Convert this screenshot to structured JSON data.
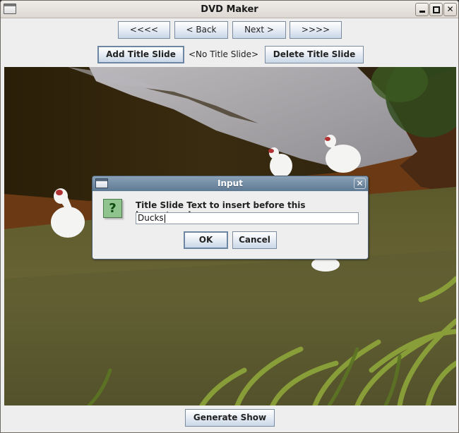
{
  "window": {
    "title": "DVD Maker",
    "controls": {
      "minimize": "minimize",
      "maximize": "maximize",
      "close": "close"
    }
  },
  "navigation": {
    "first_label": "<<<<",
    "back_label": "< Back",
    "next_label": "Next >",
    "last_label": ">>>>"
  },
  "title_slide": {
    "add_label": "Add Title Slide",
    "current_label": "<No Title Slide>",
    "delete_label": "Delete Title Slide"
  },
  "preview": {
    "description": "Photo of white ducks on grass beside a pond"
  },
  "footer": {
    "generate_label": "Generate Show"
  },
  "dialog": {
    "title": "Input",
    "icon": "question-icon",
    "icon_glyph": "?",
    "prompt": "Title Slide Text to insert before this image/movie :",
    "input_value": "Ducks",
    "ok_label": "OK",
    "cancel_label": "Cancel",
    "close_glyph": "✕"
  }
}
